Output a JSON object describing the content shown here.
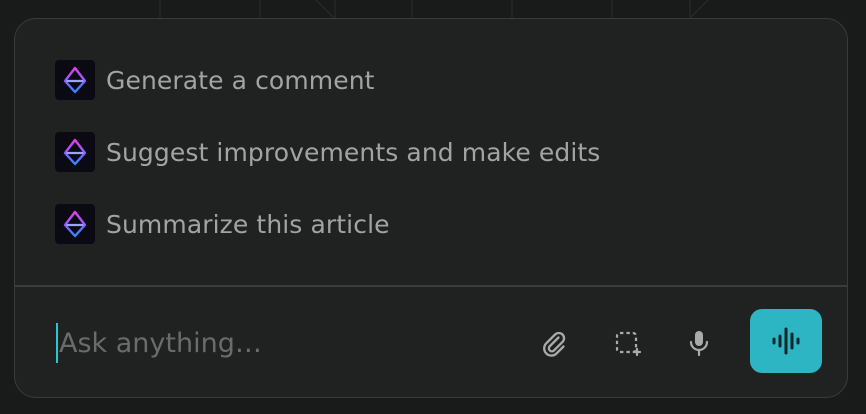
{
  "suggestions": [
    {
      "label": "Generate a comment",
      "icon": "perplexity-logo-icon"
    },
    {
      "label": "Suggest improvements and make edits",
      "icon": "perplexity-logo-icon"
    },
    {
      "label": "Summarize this article",
      "icon": "perplexity-logo-icon"
    }
  ],
  "input": {
    "placeholder": "Ask anything…",
    "value": ""
  },
  "toolbar": {
    "attach_icon": "paperclip-icon",
    "screenshot_icon": "screenshot-select-icon",
    "mic_icon": "microphone-icon",
    "voice_icon": "voice-mode-icon"
  },
  "colors": {
    "panel_bg": "#202222",
    "border": "#3a3c3c",
    "text": "#a2a4a4",
    "placeholder": "#6a6c6c",
    "accent": "#2db5c4"
  }
}
